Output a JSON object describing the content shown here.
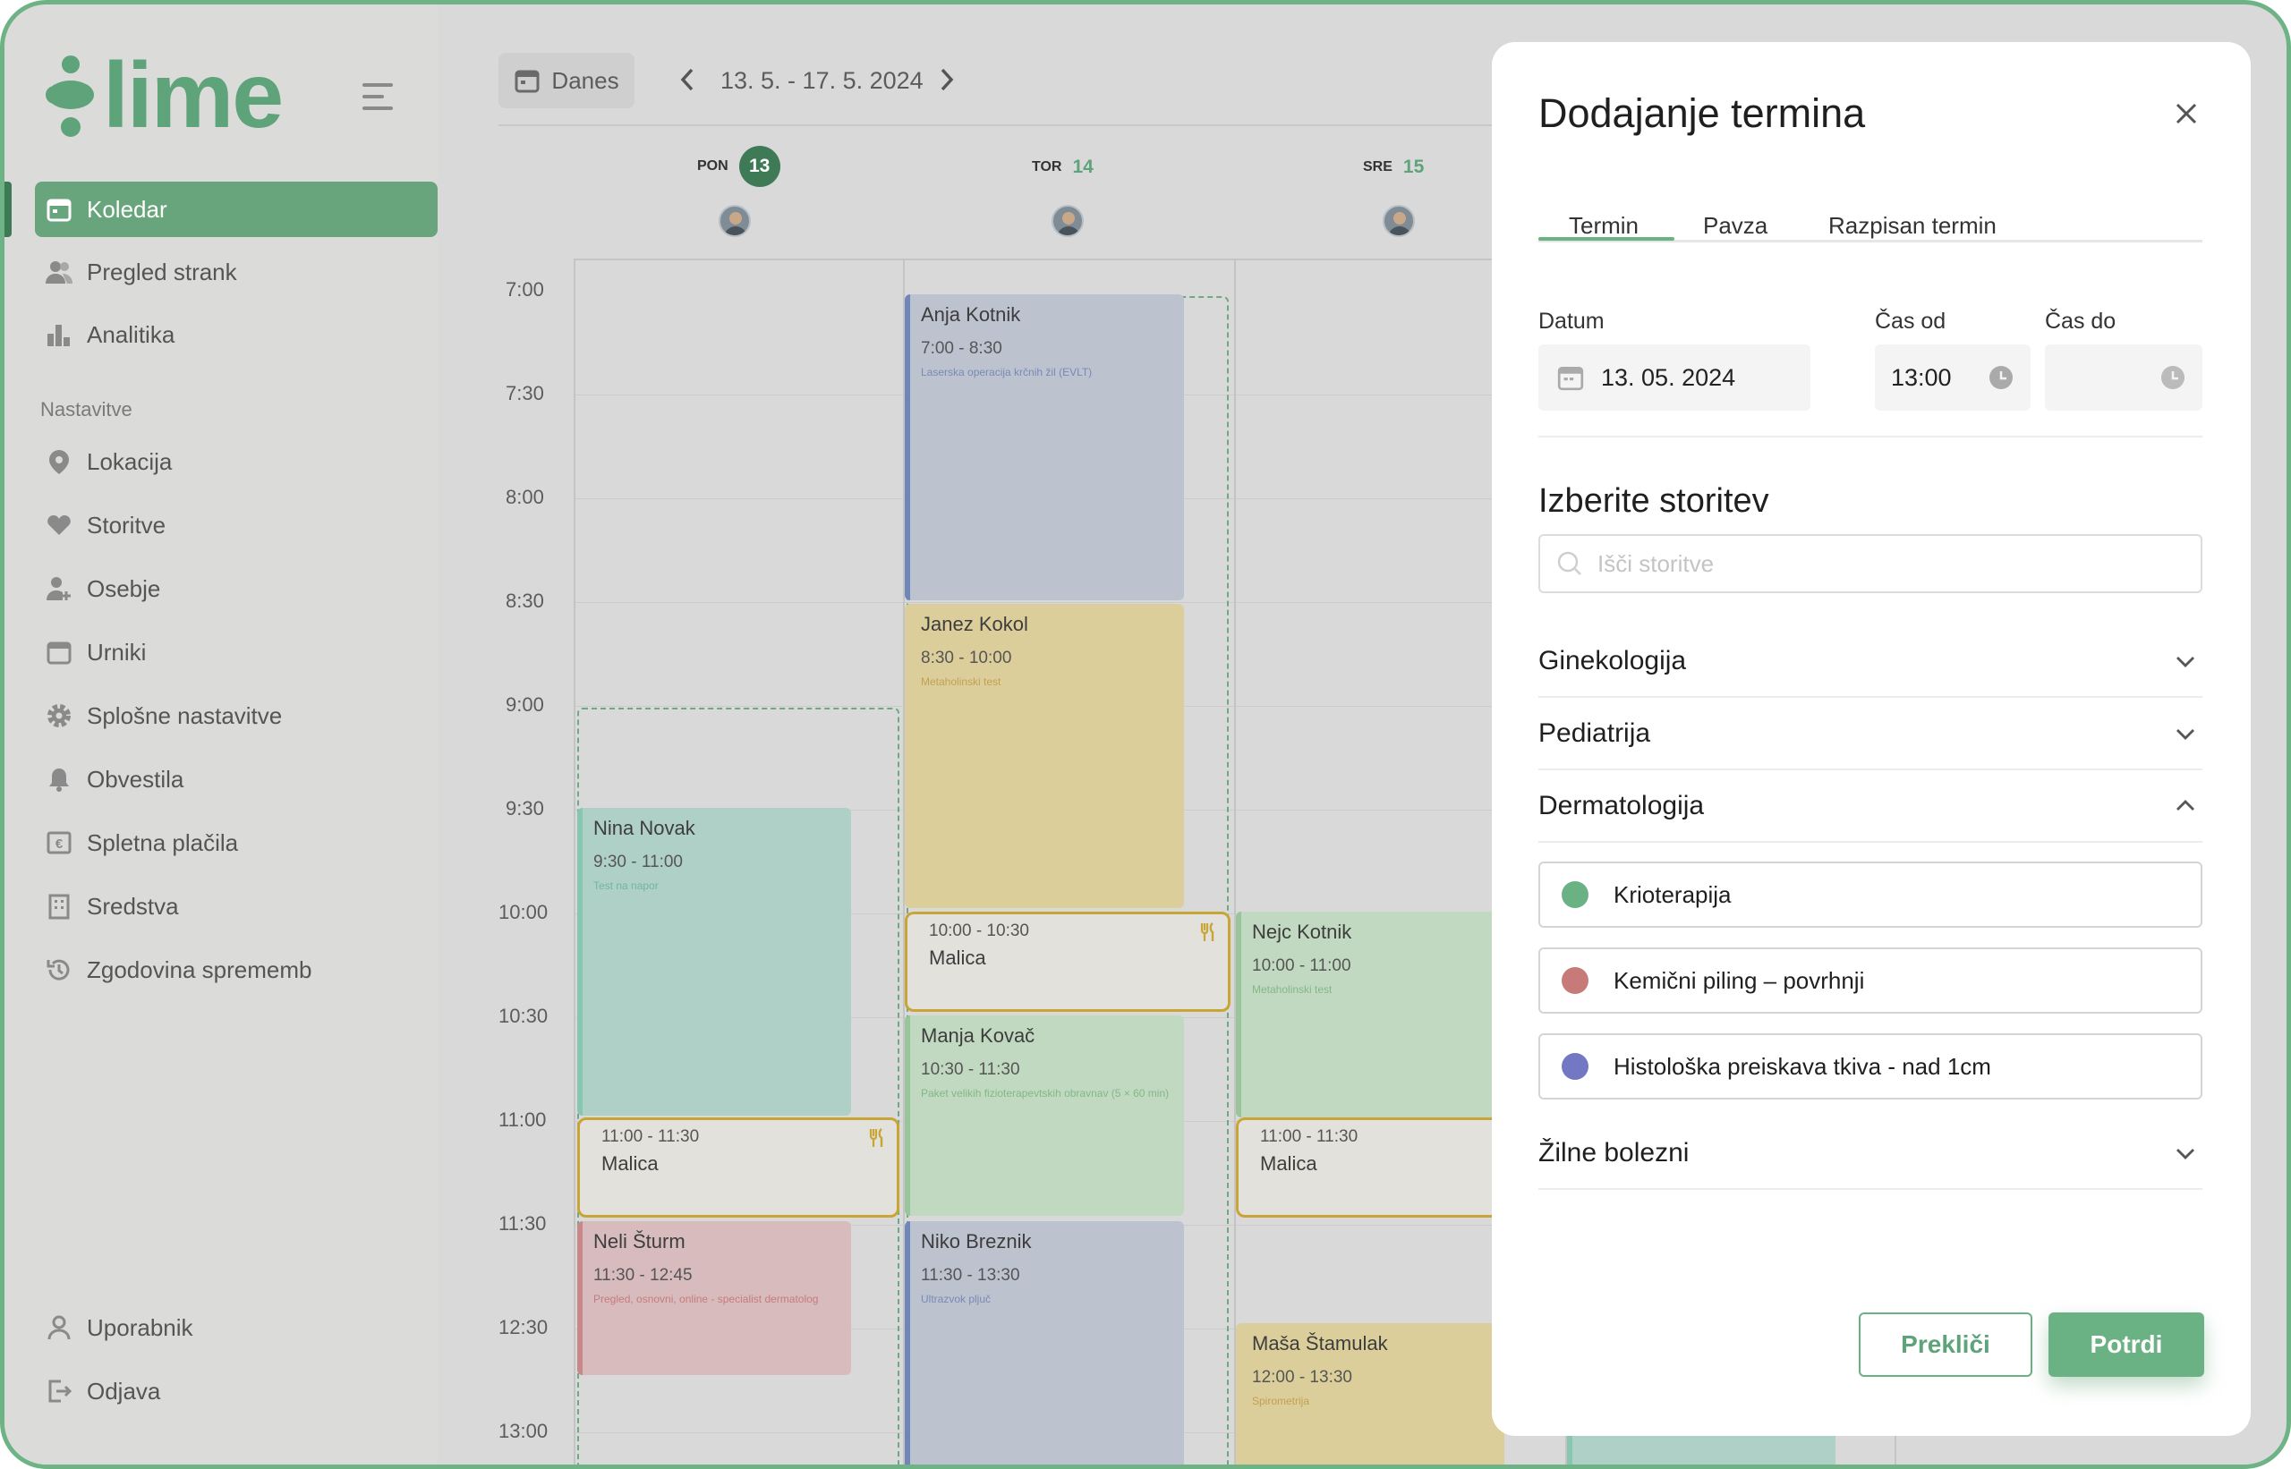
{
  "app": {
    "name": "lime",
    "brand_color": "#6ab283"
  },
  "sidebar": {
    "items": [
      {
        "label": "Koledar",
        "icon": "calendar-icon",
        "active": true
      },
      {
        "label": "Pregled strank",
        "icon": "users-icon"
      },
      {
        "label": "Analitika",
        "icon": "bar-chart-icon"
      }
    ],
    "section_label": "Nastavitve",
    "settings_items": [
      {
        "label": "Lokacija",
        "icon": "location-pin-icon"
      },
      {
        "label": "Storitve",
        "icon": "heart-hand-icon"
      },
      {
        "label": "Osebje",
        "icon": "add-person-icon"
      },
      {
        "label": "Urniki",
        "icon": "calendar-icon"
      },
      {
        "label": "Splošne nastavitve",
        "icon": "gear-icon"
      },
      {
        "label": "Obvestila",
        "icon": "bell-icon"
      },
      {
        "label": "Spletna plačila",
        "icon": "euro-icon"
      },
      {
        "label": "Sredstva",
        "icon": "building-icon"
      },
      {
        "label": "Zgodovina sprememb",
        "icon": "history-icon"
      }
    ],
    "bottom_items": [
      {
        "label": "Uporabnik",
        "icon": "user-icon"
      },
      {
        "label": "Odjava",
        "icon": "logout-icon"
      }
    ]
  },
  "calendar": {
    "today_label": "Danes",
    "date_range": "13. 5. - 17. 5. 2024",
    "days": [
      {
        "abbr": "PON",
        "num": "13",
        "today": true
      },
      {
        "abbr": "TOR",
        "num": "14"
      },
      {
        "abbr": "SRE",
        "num": "15"
      }
    ],
    "times": [
      "7:00",
      "7:30",
      "8:00",
      "8:30",
      "9:00",
      "9:30",
      "10:00",
      "10:30",
      "11:00",
      "11:30",
      "12:30",
      "13:00"
    ],
    "events": [
      {
        "name": "Anja Kotnik",
        "time": "7:00 - 8:30",
        "desc": "Laserska operacija krčnih žil (EVLT)"
      },
      {
        "name": "Janez Kokol",
        "time": "8:30 - 10:00",
        "desc": "Metaholinski test"
      },
      {
        "name": "Malica",
        "time": "10:00 - 10:30"
      },
      {
        "name": "Manja Kovač",
        "time": "10:30 - 11:30",
        "desc": "Paket velikih fizioterapevtskih obravnav (5 × 60 min)"
      },
      {
        "name": "Niko Breznik",
        "time": "11:30 - 13:30",
        "desc": "Ultrazvok pljuč"
      },
      {
        "name": "Nina Novak",
        "time": "9:30 - 11:00",
        "desc": "Test na napor"
      },
      {
        "name": "Malica",
        "time": "11:00 - 11:30"
      },
      {
        "name": "Neli Šturm",
        "time": "11:30 - 12:45",
        "desc": "Pregled, osnovni, online - specialist dermatolog"
      },
      {
        "name": "Nejc Kotnik",
        "time": "10:00 - 11:00",
        "desc": "Metaholinski test"
      },
      {
        "name": "Malica",
        "time": "11:00 - 11:30"
      },
      {
        "name": "Maša Štamulak",
        "time": "12:00 - 13:30",
        "desc": "Spirometrija"
      }
    ]
  },
  "modal": {
    "title": "Dodajanje termina",
    "tabs": [
      "Termin",
      "Pavza",
      "Razpisan termin"
    ],
    "active_tab": "Termin",
    "date_label": "Datum",
    "date_value": "13. 05. 2024",
    "from_label": "Čas od",
    "from_value": "13:00",
    "to_label": "Čas do",
    "to_value": "",
    "services_title": "Izberite storitev",
    "search_placeholder": "Išči storitve",
    "categories": [
      {
        "label": "Ginekologija",
        "expanded": false
      },
      {
        "label": "Pediatrija",
        "expanded": false
      },
      {
        "label": "Dermatologija",
        "expanded": true
      },
      {
        "label": "Žilne bolezni",
        "expanded": false
      }
    ],
    "services": [
      {
        "label": "Krioterapija",
        "color": "#6ab283"
      },
      {
        "label": "Kemični piling – povrhnji",
        "color": "#c77b78"
      },
      {
        "label": "Histološka preiskava tkiva - nad 1cm",
        "color": "#7378c2"
      }
    ],
    "cancel_label": "Prekliči",
    "confirm_label": "Potrdi"
  }
}
